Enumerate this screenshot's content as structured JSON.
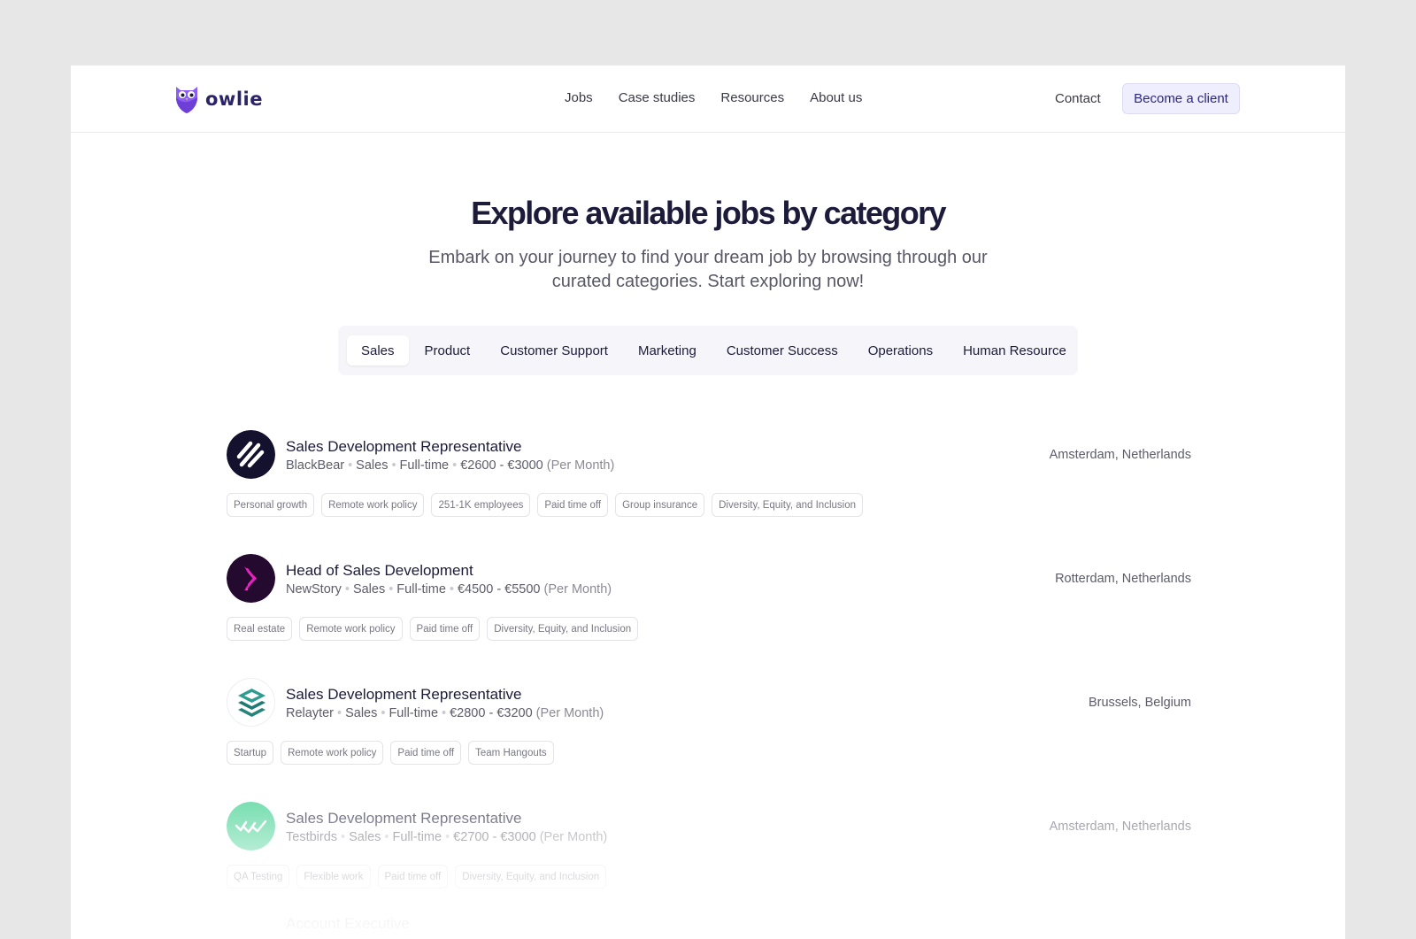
{
  "brand": {
    "name": "owlie"
  },
  "nav": {
    "links": [
      "Jobs",
      "Case studies",
      "Resources",
      "About us"
    ],
    "contact": "Contact",
    "cta": "Become a client"
  },
  "hero": {
    "title": "Explore available jobs by category",
    "subtitle": "Embark on your journey to find your dream job by browsing through our curated categories. Start exploring now!"
  },
  "tabs": {
    "active": "Sales",
    "items": [
      "Sales",
      "Product",
      "Customer Support",
      "Marketing",
      "Customer Success",
      "Operations",
      "Human Resource"
    ]
  },
  "jobs": [
    {
      "title": "Sales Development Representative",
      "company": "BlackBear",
      "department": "Sales",
      "type": "Full-time",
      "salary": "€2600 - €3000",
      "period": "(Per Month)",
      "location": "Amsterdam, Netherlands",
      "logo_icon": "blackbear-stripes-logo",
      "tags": [
        "Personal growth",
        "Remote work policy",
        "251-1K employees",
        "Paid time off",
        "Group insurance",
        "Diversity, Equity, and Inclusion"
      ]
    },
    {
      "title": "Head of Sales Development",
      "company": "NewStory",
      "department": "Sales",
      "type": "Full-time",
      "salary": "€4500 - €5500",
      "period": "(Per Month)",
      "location": "Rotterdam, Netherlands",
      "logo_icon": "newstory-chevron-logo",
      "tags": [
        "Real estate",
        "Remote work policy",
        "Paid time off",
        "Diversity, Equity, and Inclusion"
      ]
    },
    {
      "title": "Sales Development Representative",
      "company": "Relayter",
      "department": "Sales",
      "type": "Full-time",
      "salary": "€2800 - €3200",
      "period": "(Per Month)",
      "location": "Brussels, Belgium",
      "logo_icon": "relayter-layers-logo",
      "tags": [
        "Startup",
        "Remote work policy",
        "Paid time off",
        "Team Hangouts"
      ]
    },
    {
      "title": "Sales Development Representative",
      "company": "Testbirds",
      "department": "Sales",
      "type": "Full-time",
      "salary": "€2700 - €3000",
      "period": "(Per Month)",
      "location": "Amsterdam, Netherlands",
      "logo_icon": "testbirds-checks-logo",
      "tags": [
        "QA Testing",
        "Flexible work",
        "Paid time off",
        "Diversity, Equity, and Inclusion"
      ]
    }
  ],
  "next_job_partial_title": "Account Executive",
  "colors": {
    "brand": "#2a2368",
    "accent_purple": "#8b5cf6",
    "cta_bg": "#efeefc",
    "page_bg": "#e7e7e7"
  }
}
